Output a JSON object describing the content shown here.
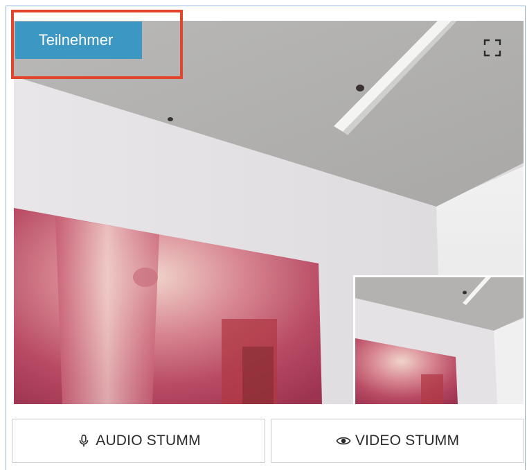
{
  "participant": {
    "label": "Teilnehmer"
  },
  "controls": {
    "audio_mute_label": "AUDIO STUMM",
    "video_mute_label": "VIDEO STUMM"
  },
  "icons": {
    "audio": "microphone-icon",
    "video": "eye-icon",
    "fullscreen": "fullscreen-icon"
  },
  "colors": {
    "badge": "#3c97c2",
    "highlight": "#e1452b",
    "frame": "#8fb3d9"
  }
}
